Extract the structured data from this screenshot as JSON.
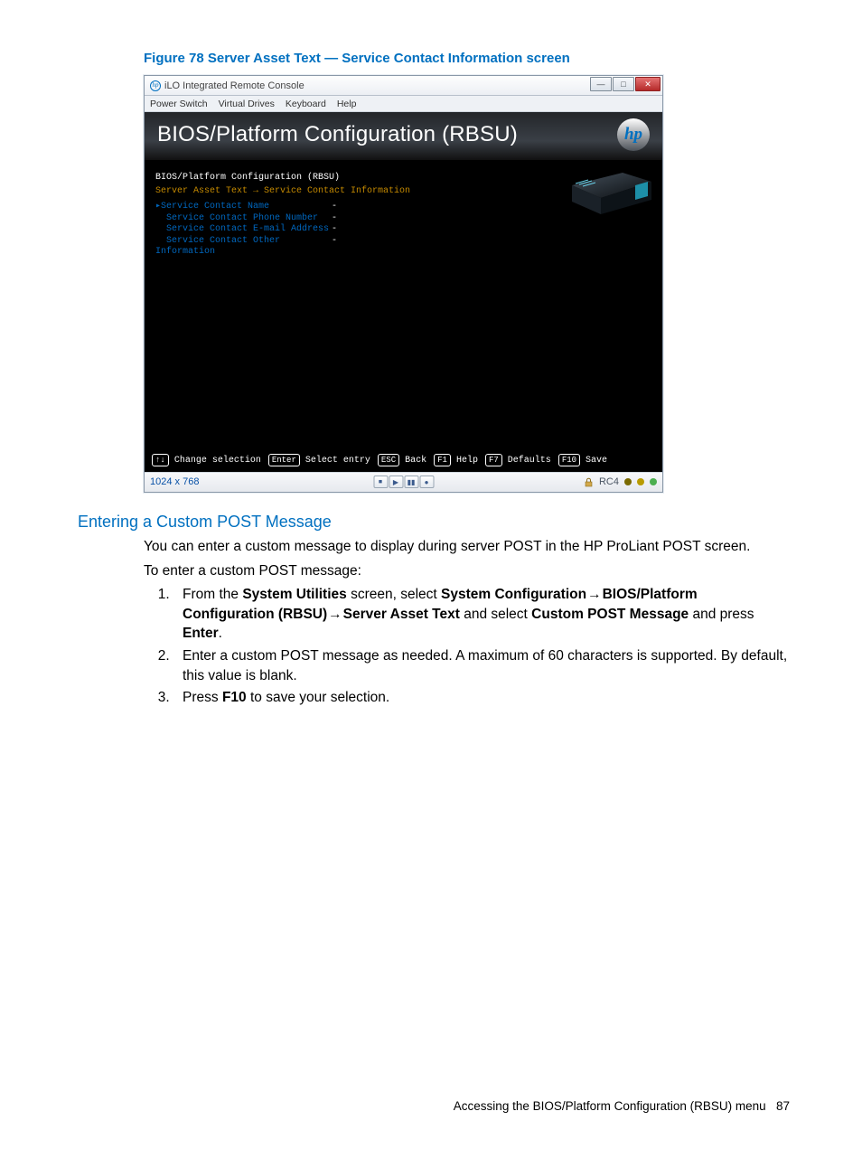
{
  "figure_caption": "Figure 78 Server Asset Text — Service Contact Information screen",
  "window": {
    "title": "iLO Integrated Remote Console",
    "menus": [
      "Power Switch",
      "Virtual Drives",
      "Keyboard",
      "Help"
    ],
    "win_btn_min_glyph": "—",
    "win_btn_max_glyph": "□",
    "win_btn_close_glyph": "✕"
  },
  "bios": {
    "header_title": "BIOS/Platform Configuration (RBSU)",
    "hp_logo_text": "hp",
    "path_root": "BIOS/Platform Configuration (RBSU)",
    "path_breadcrumb": "Server Asset Text → Service Contact Information",
    "options": [
      {
        "label": "Service Contact Name",
        "value": "-",
        "selected": true
      },
      {
        "label": "Service Contact Phone Number",
        "value": "-",
        "selected": false
      },
      {
        "label": "Service Contact E-mail Address",
        "value": "-",
        "selected": false
      },
      {
        "label": "Service Contact Other Information",
        "value": "-",
        "selected": false
      }
    ],
    "keys": [
      {
        "cap": "↑↓",
        "label": "Change selection"
      },
      {
        "cap": "Enter",
        "label": "Select entry"
      },
      {
        "cap": "ESC",
        "label": "Back"
      },
      {
        "cap": "F1",
        "label": "Help"
      },
      {
        "cap": "F7",
        "label": "Defaults"
      },
      {
        "cap": "F10",
        "label": "Save"
      }
    ]
  },
  "statusbar": {
    "resolution": "1024 x 768",
    "center_btns": [
      "⏹",
      "▶",
      "▮▮",
      "●"
    ],
    "rc_label": "RC4"
  },
  "section_heading": "Entering a Custom POST Message",
  "para1": "You can enter a custom message to display during server POST in the HP ProLiant POST screen.",
  "para2": "To enter a custom POST message:",
  "step1": {
    "prefix": "From the ",
    "b1": "System Utilities",
    "mid1": " screen, select ",
    "b2": "System Configuration",
    "arrow1": "→",
    "b3": "BIOS/Platform Configuration (RBSU)",
    "arrow2": "→",
    "b4": "Server Asset Text",
    "mid2": " and select ",
    "b5": "Custom POST Message",
    "mid3": " and press ",
    "b6": "Enter",
    "suffix": "."
  },
  "step2": "Enter a custom POST message as needed. A maximum of 60 characters is supported. By default, this value is blank.",
  "step3": {
    "prefix": "Press ",
    "b1": "F10",
    "suffix": " to save your selection."
  },
  "footer_text": "Accessing the BIOS/Platform Configuration (RBSU) menu",
  "footer_page": "87",
  "hp_small_glyph": "hp"
}
